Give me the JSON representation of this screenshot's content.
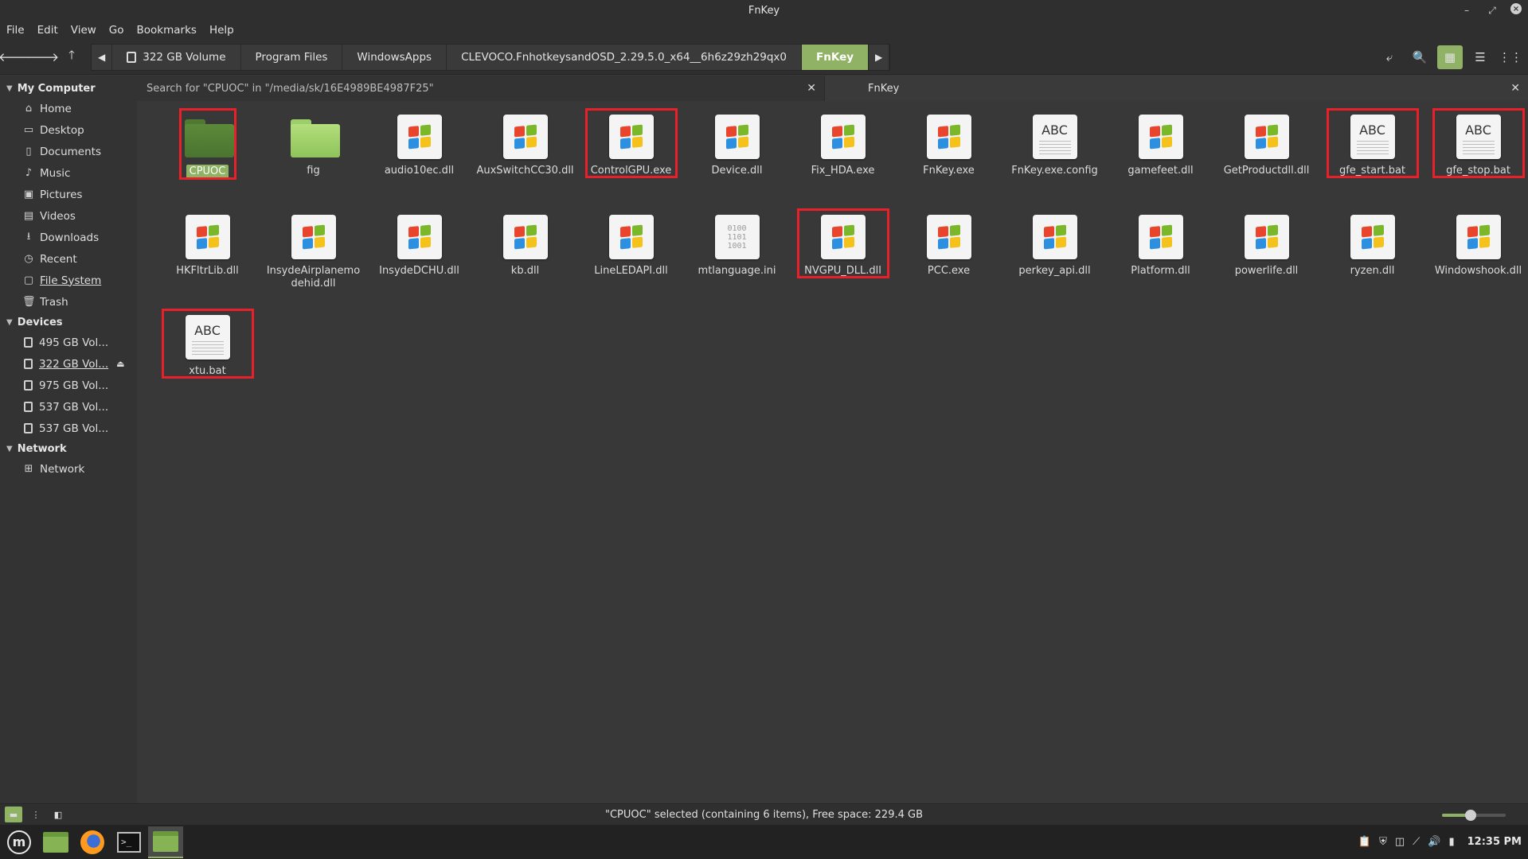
{
  "window": {
    "title": "FnKey"
  },
  "menu": [
    "File",
    "Edit",
    "View",
    "Go",
    "Bookmarks",
    "Help"
  ],
  "breadcrumbs": [
    "322 GB Volume",
    "Program Files",
    "WindowsApps",
    "CLEVOCO.FnhotkeysandOSD_2.29.5.0_x64__6h6z29zh29qx0",
    "FnKey"
  ],
  "sidebar": {
    "my_computer": {
      "title": "My Computer",
      "items": [
        {
          "label": "Home",
          "icon": "home-icon"
        },
        {
          "label": "Desktop",
          "icon": "desktop-icon"
        },
        {
          "label": "Documents",
          "icon": "documents-icon"
        },
        {
          "label": "Music",
          "icon": "music-icon"
        },
        {
          "label": "Pictures",
          "icon": "pictures-icon"
        },
        {
          "label": "Videos",
          "icon": "videos-icon"
        },
        {
          "label": "Downloads",
          "icon": "downloads-icon"
        },
        {
          "label": "Recent",
          "icon": "recent-icon"
        },
        {
          "label": "File System",
          "icon": "filesystem-icon"
        },
        {
          "label": "Trash",
          "icon": "trash-icon"
        }
      ]
    },
    "devices": {
      "title": "Devices",
      "items": [
        "495 GB Vol...",
        "322 GB Vol...",
        "975 GB Vol...",
        "537 GB Vol...",
        "537 GB Vol..."
      ]
    },
    "network": {
      "title": "Network",
      "items": [
        "Network"
      ]
    }
  },
  "tabs": [
    {
      "label": "Search for \"CPUOC\" in \"/media/sk/16E4989BE4987F25\""
    },
    {
      "label": "FnKey"
    }
  ],
  "files": [
    {
      "name": "CPUOC",
      "type": "folder-dark",
      "selected": true,
      "highlight": true
    },
    {
      "name": "fig",
      "type": "folder",
      "selected": false,
      "highlight": false
    },
    {
      "name": "audio10ec.dll",
      "type": "exe",
      "highlight": false
    },
    {
      "name": "AuxSwitchCC30.dll",
      "type": "exe",
      "highlight": false
    },
    {
      "name": "ControlGPU.exe",
      "type": "exe",
      "highlight": true
    },
    {
      "name": "Device.dll",
      "type": "exe",
      "highlight": false
    },
    {
      "name": "Fix_HDA.exe",
      "type": "exe",
      "highlight": false
    },
    {
      "name": "FnKey.exe",
      "type": "exe",
      "highlight": false
    },
    {
      "name": "FnKey.exe.config",
      "type": "text",
      "highlight": false
    },
    {
      "name": "gamefeet.dll",
      "type": "exe",
      "highlight": false
    },
    {
      "name": "GetProductdll.dll",
      "type": "exe",
      "highlight": false
    },
    {
      "name": "gfe_start.bat",
      "type": "text",
      "highlight": true
    },
    {
      "name": "gfe_stop.bat",
      "type": "text",
      "highlight": true
    },
    {
      "name": "HKFltrLib.dll",
      "type": "exe",
      "highlight": false
    },
    {
      "name": "InsydeAirplanemodehid.dll",
      "type": "exe",
      "highlight": false
    },
    {
      "name": "InsydeDCHU.dll",
      "type": "exe",
      "highlight": false
    },
    {
      "name": "kb.dll",
      "type": "exe",
      "highlight": false
    },
    {
      "name": "LineLEDAPI.dll",
      "type": "exe",
      "highlight": false
    },
    {
      "name": "mtlanguage.ini",
      "type": "binary",
      "highlight": false
    },
    {
      "name": "NVGPU_DLL.dll",
      "type": "exe",
      "highlight": true
    },
    {
      "name": "PCC.exe",
      "type": "exe",
      "highlight": false
    },
    {
      "name": "perkey_api.dll",
      "type": "exe",
      "highlight": false
    },
    {
      "name": "Platform.dll",
      "type": "exe",
      "highlight": false
    },
    {
      "name": "powerlife.dll",
      "type": "exe",
      "highlight": false
    },
    {
      "name": "ryzen.dll",
      "type": "exe",
      "highlight": false
    },
    {
      "name": "Windowshook.dll",
      "type": "exe",
      "highlight": false
    },
    {
      "name": "xtu.bat",
      "type": "text",
      "highlight": true
    }
  ],
  "icons": {
    "text_glyph": "ABC",
    "binary_glyph": "0100\n1101\n1001"
  },
  "status": {
    "text": "\"CPUOC\" selected (containing 6 items), Free space: 229.4 GB",
    "zoom_fraction": 0.45
  },
  "taskbar": {
    "clock": "12:35 PM"
  },
  "colors": {
    "accent": "#8fb264",
    "highlight_box": "#e8202a",
    "background": "#383838"
  }
}
